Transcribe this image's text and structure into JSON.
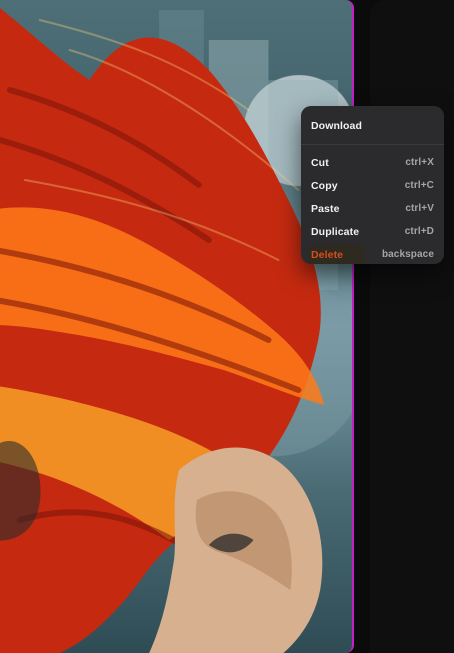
{
  "context_menu": {
    "download_label": "Download",
    "items": [
      {
        "label": "Cut",
        "shortcut": "ctrl+X"
      },
      {
        "label": "Copy",
        "shortcut": "ctrl+C"
      },
      {
        "label": "Paste",
        "shortcut": "ctrl+V"
      },
      {
        "label": "Duplicate",
        "shortcut": "ctrl+D"
      },
      {
        "label": "Delete",
        "shortcut": "backspace"
      }
    ]
  },
  "colors": {
    "canvas_border": "#c61ec8",
    "menu_bg": "#2b2b2d",
    "danger": "#d84d1b"
  }
}
